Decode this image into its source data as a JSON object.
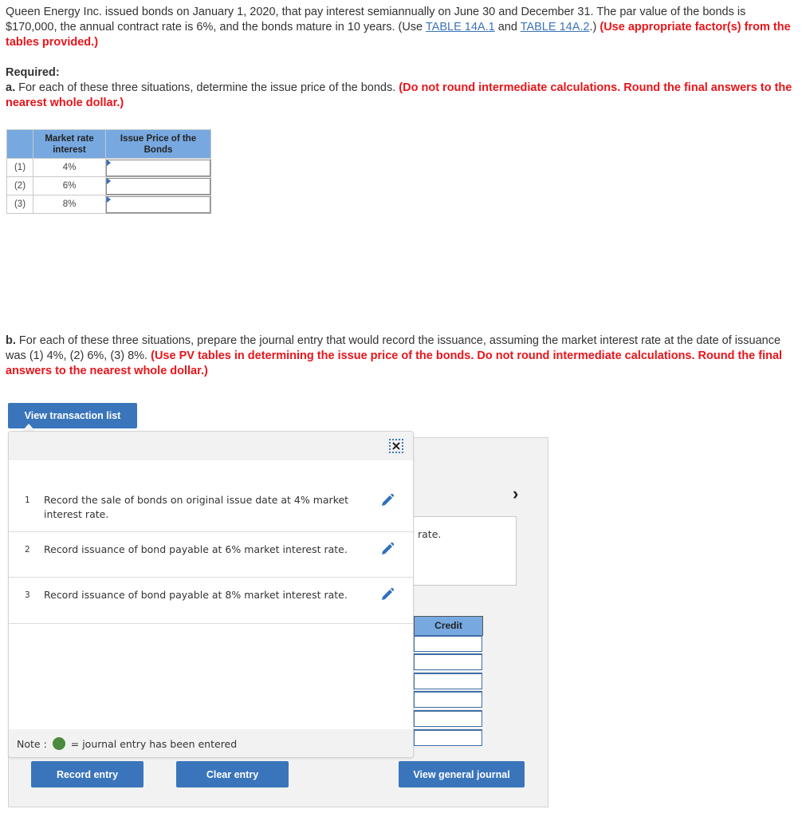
{
  "problem": {
    "text_1": "Queen Energy Inc. issued bonds on January 1, 2020, that pay interest semiannually on June 30 and December 31. The par value of the bonds is $170,000, the annual contract rate is 6%, and the bonds mature in 10 years. (Use ",
    "link_1": "TABLE 14A.1",
    "text_and": " and ",
    "link_2": "TABLE 14A.2",
    "text_close": ".) ",
    "instruction": "(Use appropriate factor(s) from the tables provided.)"
  },
  "required": {
    "label": "Required:",
    "part_a_prefix": "a.",
    "part_a_text": " For each of these three situations, determine the issue price of the bonds. ",
    "part_a_instruction": "(Do not round intermediate calculations. Round the final answers to the nearest whole dollar.)"
  },
  "price_table": {
    "headers": [
      "",
      "Market rate interest",
      "Issue Price of the Bonds"
    ],
    "rows": [
      {
        "index": "(1)",
        "rate": "4%",
        "price": ""
      },
      {
        "index": "(2)",
        "rate": "6%",
        "price": ""
      },
      {
        "index": "(3)",
        "rate": "8%",
        "price": ""
      }
    ]
  },
  "part_b": {
    "prefix": "b.",
    "text": " For each of these three situations, prepare the journal entry that would record the issuance, assuming the market interest rate at the date of issuance was (1) 4%, (2) 6%, (3) 8%. ",
    "instruction": "(Use PV tables in determining the issue price of the bonds. Do not round intermediate calculations. Round the final answers to the nearest whole dollar.)"
  },
  "journal": {
    "view_transaction_list": "View transaction list",
    "close_icon": "×",
    "next_icon": "›",
    "description_partial": "rate.",
    "credit_header": "Credit",
    "credit_rows": 6,
    "transactions": [
      {
        "num": "1",
        "text": "Record the sale of bonds on original issue date at 4% market interest rate."
      },
      {
        "num": "2",
        "text": "Record issuance of bond payable at 6% market interest rate."
      },
      {
        "num": "3",
        "text": "Record issuance of bond payable at 8% market interest rate."
      }
    ],
    "note_prefix": "Note :",
    "note_text": "= journal entry has been entered",
    "note_dot_color": "#4c8a3d",
    "record_entry": "Record entry",
    "clear_entry": "Clear entry",
    "view_general_journal": "View general journal"
  },
  "colors": {
    "accent": "#3a75bb",
    "header_blue": "#77a9e0",
    "instruction_red": "#e8151b",
    "link_blue": "#3b73b9"
  }
}
